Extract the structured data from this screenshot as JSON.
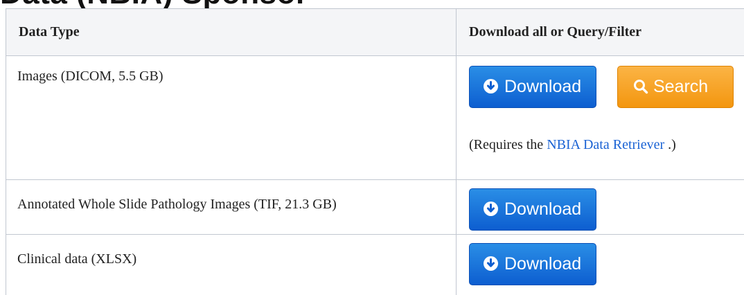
{
  "page": {
    "heading": "Data (NBIA) Sponsor"
  },
  "table": {
    "headers": [
      "Data Type",
      "Download all or Query/Filter"
    ],
    "rows": [
      {
        "data_type": "Images (DICOM,  5.5 GB)",
        "buttons": [
          "Download",
          "Search"
        ],
        "note_prefix": "(Requires the ",
        "note_link": "NBIA Data Retriever",
        "note_suffix": " .)"
      },
      {
        "data_type": "Annotated Whole Slide Pathology Images (TIF, 21.3 GB)",
        "buttons": [
          "Download"
        ]
      },
      {
        "data_type": "Clinical data (XLSX)",
        "buttons": [
          "Download"
        ]
      }
    ]
  },
  "colors": {
    "download_button": "#0d5ed0",
    "search_button": "#f3960f",
    "link": "#1b63d4",
    "header_bg": "#f4f5f7",
    "border": "#c1c7d0"
  },
  "icons": {
    "download": "download-circle-icon",
    "search": "search-icon"
  }
}
